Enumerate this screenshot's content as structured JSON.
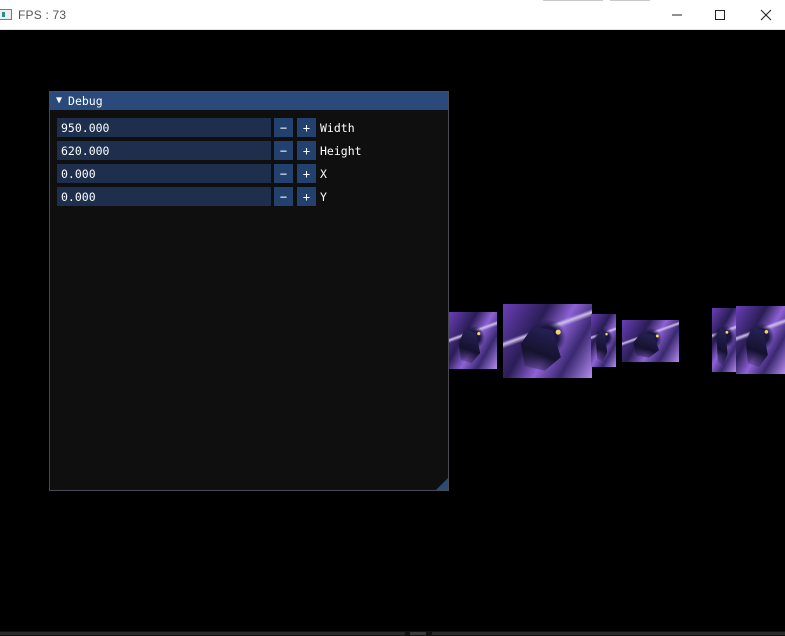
{
  "window": {
    "title": "FPS : 73",
    "controls": [
      "minimize-icon",
      "maximize-icon",
      "close-icon"
    ]
  },
  "debug_panel": {
    "title": "Debug",
    "collapse_icon": "triangle-down-icon",
    "minus_label": "−",
    "plus_label": "+",
    "fields": [
      {
        "value": "950.000",
        "label": "Width"
      },
      {
        "value": "620.000",
        "label": "Height"
      },
      {
        "value": "0.000",
        "label": "X"
      },
      {
        "value": "0.000",
        "label": "Y"
      }
    ]
  },
  "colors": {
    "imgui_title_bg": "#294a7a",
    "imgui_frame_bg": "#1d2f4c",
    "imgui_button": "#23416e",
    "imgui_window_bg": "#0f0f10",
    "scene_bg": "#000000"
  }
}
